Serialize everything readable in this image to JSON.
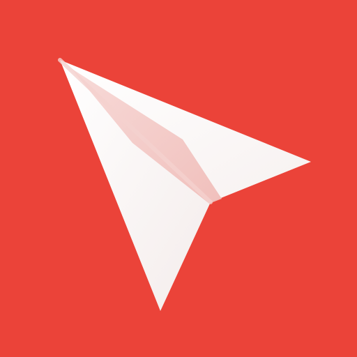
{
  "icon": {
    "name": "paper-plane-icon",
    "background_color": "#EB4339",
    "plane_color": "#FFFFFF",
    "fold_shadow_color": "#F3C4C1"
  }
}
